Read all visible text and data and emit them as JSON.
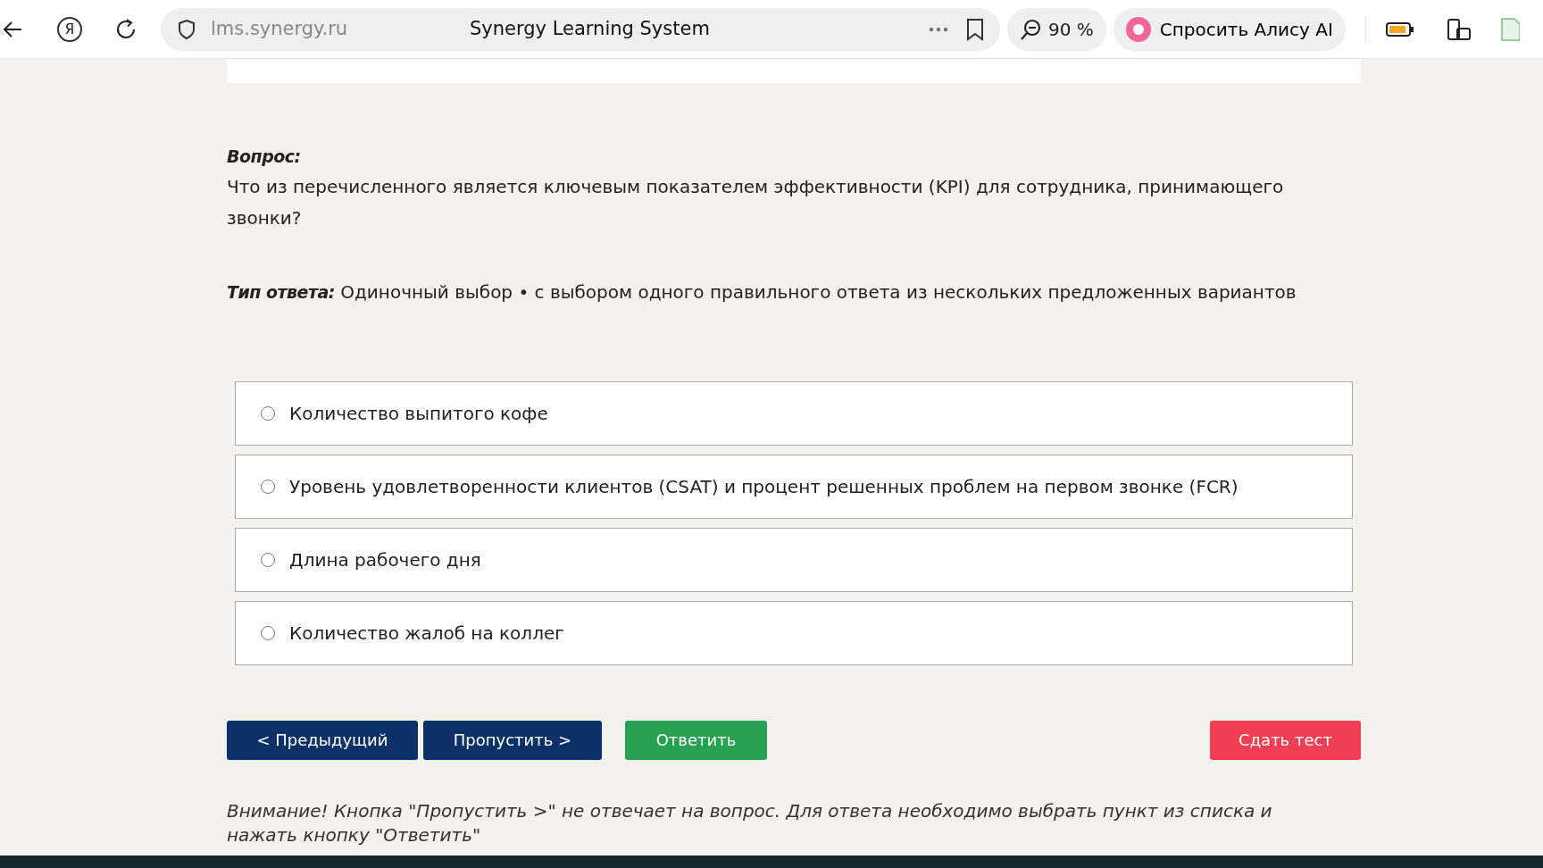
{
  "browser": {
    "logo_glyph": "Я",
    "address": "lms.synergy.ru",
    "title": "Synergy Learning System",
    "zoom": "90 %",
    "assistant_button": "Спросить Алису AI"
  },
  "question": {
    "label": "Вопрос:",
    "text": "Что из перечисленного является ключевым показателем эффективности (KPI) для сотрудника, принимающего звонки?"
  },
  "answer_type": {
    "label": "Тип ответа:",
    "text": "Одиночный выбор • с выбором одного правильного ответа из нескольких предложенных вариантов"
  },
  "options": [
    {
      "label": "Количество выпитого кофе",
      "selected": false
    },
    {
      "label": "Уровень удовлетворенности клиентов (CSAT) и процент решенных проблем на первом звонке (FCR)",
      "selected": false
    },
    {
      "label": "Длина рабочего дня",
      "selected": false
    },
    {
      "label": "Количество жалоб на коллег",
      "selected": false
    }
  ],
  "buttons": [
    {
      "label": "< Предыдущий",
      "kind": "nav"
    },
    {
      "label": "Пропустить >",
      "kind": "nav"
    },
    {
      "label": "Ответить",
      "kind": "answer"
    },
    {
      "label": "Сдать тест",
      "kind": "finish"
    }
  ],
  "notice": "Внимание! Кнопка \"Пропустить >\" не отвечает на вопрос. Для ответа необходимо выбрать пункт из списка и нажать кнопку \"Ответить\""
}
